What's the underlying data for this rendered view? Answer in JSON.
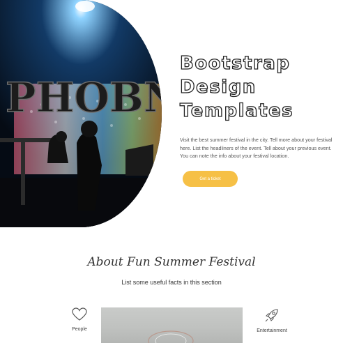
{
  "hero": {
    "title_lines": [
      "Bootstrap",
      "Design",
      "Templates"
    ],
    "description": "Visit the best summer festival in the city. Tell more about your festival here. List the headliners of the event. Tell about your previous event. You can note the info about your festival location.",
    "cta_label": "Get a ticket",
    "sign_text": "PHOBN",
    "accent_color": "#f6c046"
  },
  "about": {
    "title": "About Fun Summer Festival",
    "subtitle": "List some useful facts in this section",
    "features": [
      {
        "label": "People",
        "icon": "heart-icon"
      },
      {
        "label": "Entertainment",
        "icon": "rocket-icon"
      }
    ]
  }
}
